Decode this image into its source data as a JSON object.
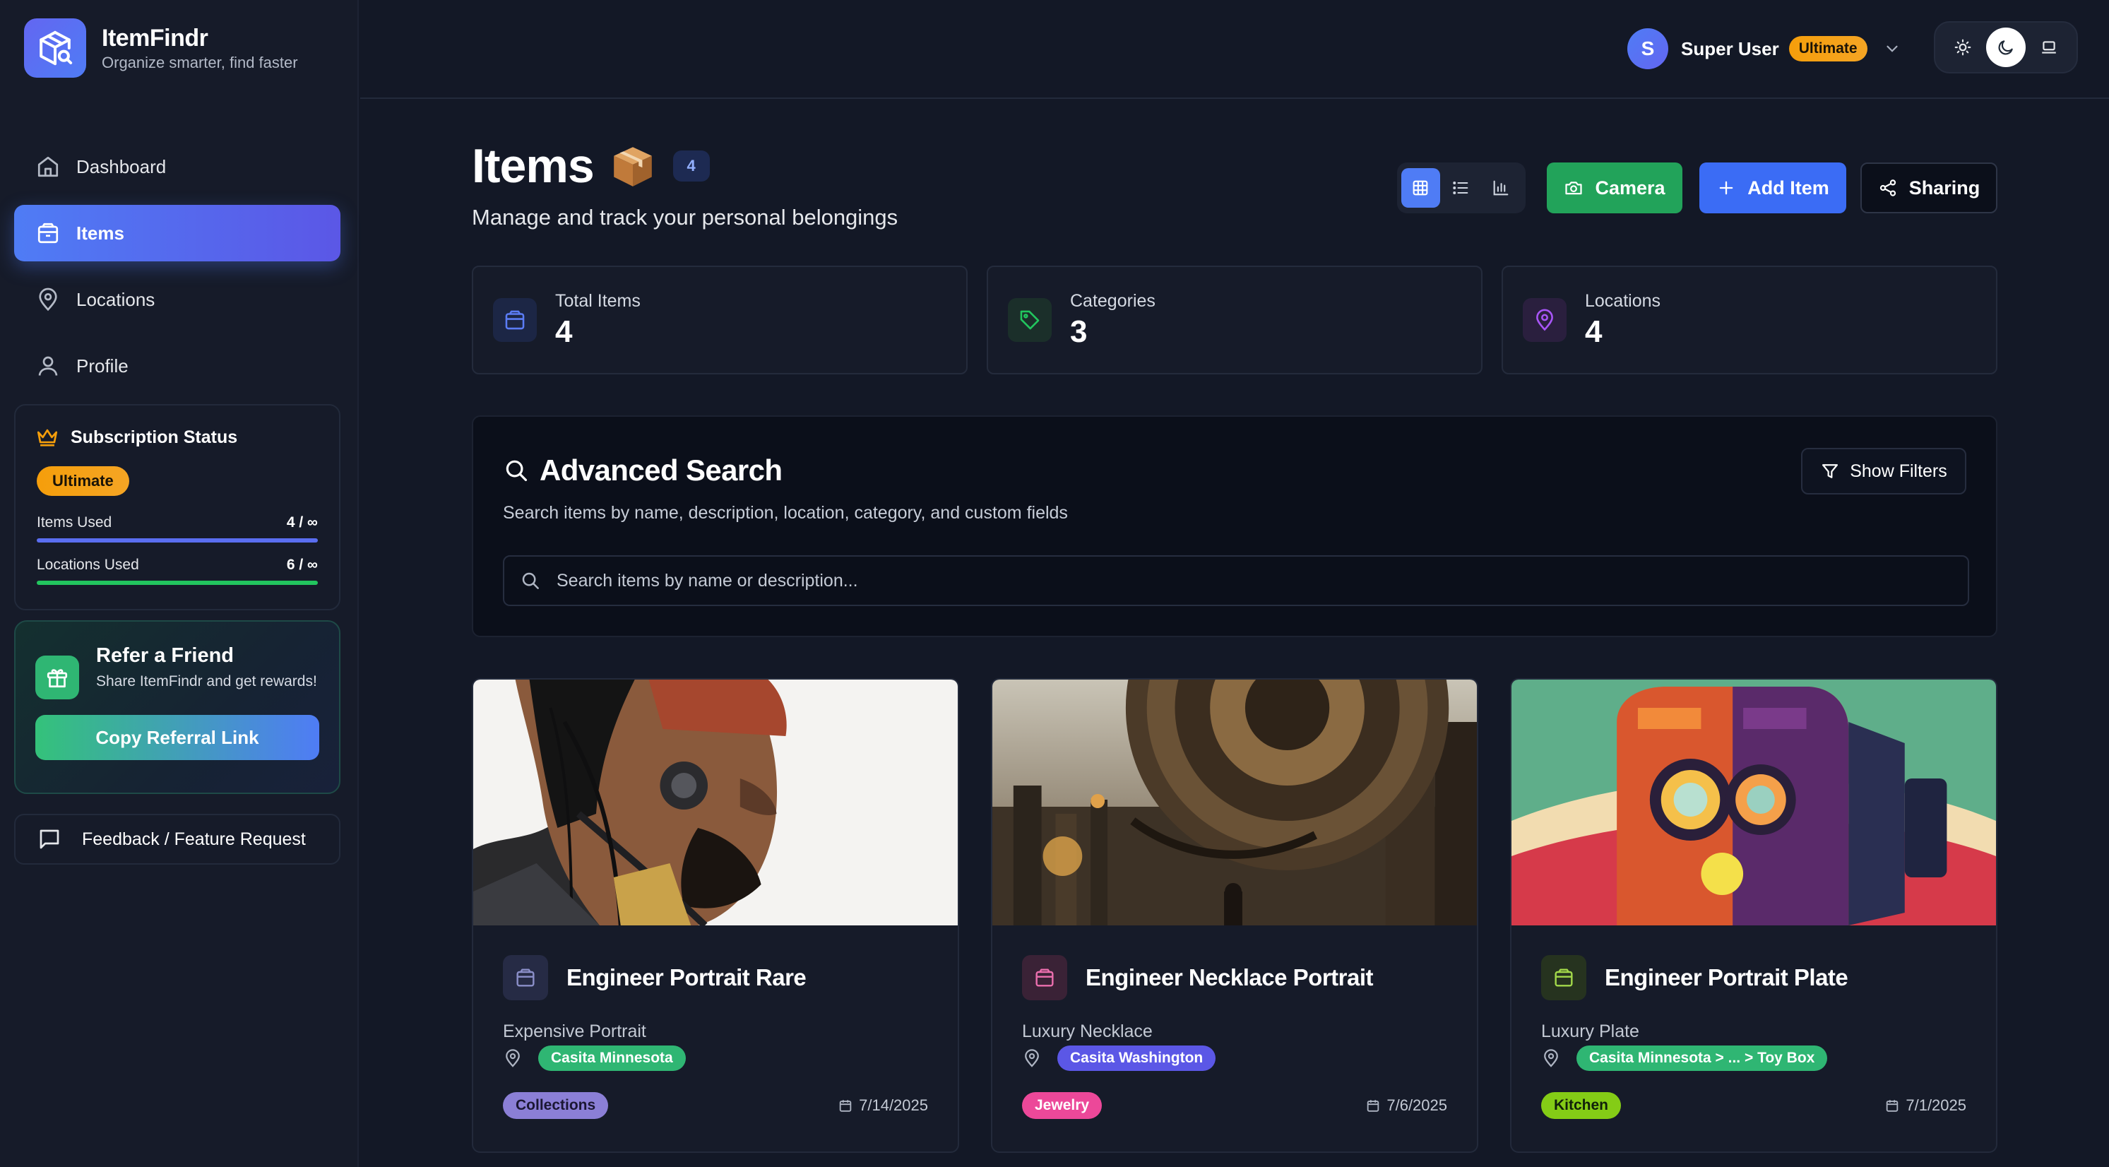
{
  "app": {
    "name": "ItemFindr",
    "tagline": "Organize smarter, find faster"
  },
  "sidebar": {
    "nav": [
      {
        "label": "Dashboard",
        "icon": "home-icon",
        "active": false
      },
      {
        "label": "Items",
        "icon": "package-icon",
        "active": true
      },
      {
        "label": "Locations",
        "icon": "map-pin-icon",
        "active": false
      },
      {
        "label": "Profile",
        "icon": "user-icon",
        "active": false
      }
    ],
    "subscription": {
      "title": "Subscription Status",
      "tier": "Ultimate",
      "items_label": "Items Used",
      "items_value": "4 / ∞",
      "locations_label": "Locations Used",
      "locations_value": "6 / ∞"
    },
    "referral": {
      "title": "Refer a Friend",
      "subtitle": "Share ItemFindr and get rewards!",
      "button": "Copy Referral Link"
    },
    "feedback": "Feedback / Feature Request"
  },
  "topbar": {
    "user": {
      "initial": "S",
      "name": "Super User",
      "tier": "Ultimate"
    },
    "theme_active": "dark"
  },
  "header": {
    "title": "Items",
    "emoji": "📦",
    "count": "4",
    "subtitle": "Manage and track your personal belongings",
    "view_active": "grid",
    "buttons": {
      "camera": "Camera",
      "add": "Add Item",
      "share": "Sharing"
    }
  },
  "stats": [
    {
      "label": "Total Items",
      "value": "4",
      "icon": "package-icon",
      "color": "#5b7cf5"
    },
    {
      "label": "Categories",
      "value": "3",
      "icon": "tag-icon",
      "color": "#22c55e"
    },
    {
      "label": "Locations",
      "value": "4",
      "icon": "map-pin-icon",
      "color": "#a855f7"
    }
  ],
  "search": {
    "title": "Advanced Search",
    "description": "Search items by name, description, location, category, and custom fields",
    "filters_button": "Show Filters",
    "placeholder": "Search items by name or description...",
    "value": ""
  },
  "items": [
    {
      "title": "Engineer Portrait Rare",
      "description": "Expensive Portrait",
      "location": "Casita Minnesota",
      "location_color": "#2fb673",
      "category": "Collections",
      "category_bg": "#8b7fd6",
      "category_fg": "#1b1733",
      "date": "7/14/2025",
      "icon_color": "#8b8fc9",
      "icon_bg": "#262b45"
    },
    {
      "title": "Engineer Necklace Portrait",
      "description": "Luxury Necklace",
      "location": "Casita Washington",
      "location_color": "#5b57e6",
      "category": "Jewelry",
      "category_bg": "#ec4899",
      "category_fg": "#ffffff",
      "date": "7/6/2025",
      "icon_color": "#ec6fae",
      "icon_bg": "#3a2236"
    },
    {
      "title": "Engineer Portrait Plate",
      "description": "Luxury Plate",
      "location": "Casita Minnesota > ... > Toy Box",
      "location_color": "#2fb673",
      "category": "Kitchen",
      "category_bg": "#84cc16",
      "category_fg": "#10200a",
      "date": "7/1/2025",
      "icon_color": "#a3d94a",
      "icon_bg": "#26331f"
    }
  ]
}
